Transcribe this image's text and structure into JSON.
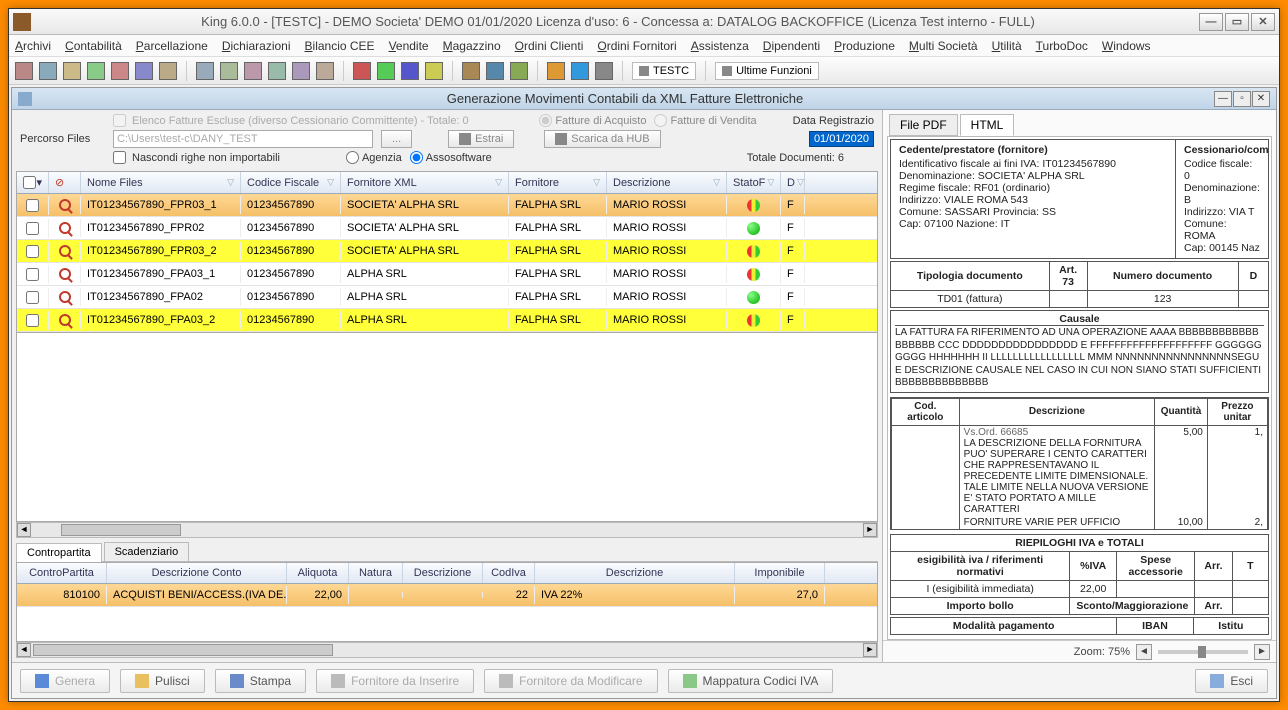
{
  "title": "King 6.0.0 - [TESTC] -    DEMO  Societa' DEMO    01/01/2020     Licenza d'uso: 6 - Concessa a:  DATALOG BACKOFFICE (Licenza Test interno - FULL)",
  "menu": [
    "Archivi",
    "Contabilità",
    "Parcellazione",
    "Dichiarazioni",
    "Bilancio CEE",
    "Vendite",
    "Magazzino",
    "Ordini Clienti",
    "Ordini Fornitori",
    "Assistenza",
    "Dipendenti",
    "Produzione",
    "Multi Società",
    "Utilità",
    "TurboDoc",
    "Windows"
  ],
  "toolbar_txt1": "TESTC",
  "toolbar_txt2": "Ultime Funzioni",
  "subwin_title": "Generazione Movimenti Contabili da XML Fatture Elettroniche",
  "filters": {
    "elenco_escluse": "Elenco Fatture Escluse (diverso Cessionario Committente) - Totale: 0",
    "fatture_acquisto": "Fatture di Acquisto",
    "fatture_vendita": "Fatture di Vendita",
    "data_reg": "Data Registrazio",
    "percorso_label": "Percorso Files",
    "percorso": "C:\\Users\\test-c\\DANY_TEST",
    "browse": "...",
    "nascondi": "Nascondi righe non importabili",
    "agenzia": "Agenzia",
    "assosoftware": "Assosoftware",
    "estrai": "Estrai",
    "scarica": "Scarica da HUB",
    "totale_doc": "Totale Documenti: 6",
    "date": "01/01/2020"
  },
  "grid": {
    "cols": [
      "",
      "",
      "Nome Files",
      "Codice Fiscale",
      "Fornitore XML",
      "Fornitore",
      "Descrizione",
      "StatoF",
      "D"
    ],
    "rows": [
      {
        "cls": "row-orange",
        "file": "IT01234567890_FPR03_1",
        "cf": "01234567890",
        "fxml": "SOCIETA' ALPHA SRL",
        "forn": "FALPHA SRL",
        "descr": "MARIO ROSSI",
        "stato": "ryg",
        "d": "F"
      },
      {
        "cls": "row-white",
        "file": "IT01234567890_FPR02",
        "cf": "01234567890",
        "fxml": "SOCIETA' ALPHA SRL",
        "forn": "FALPHA SRL",
        "descr": "MARIO ROSSI",
        "stato": "green",
        "d": "F"
      },
      {
        "cls": "row-yellow",
        "file": "IT01234567890_FPR03_2",
        "cf": "01234567890",
        "fxml": "SOCIETA' ALPHA SRL",
        "forn": "FALPHA SRL",
        "descr": "MARIO ROSSI",
        "stato": "ryg",
        "d": "F"
      },
      {
        "cls": "row-white",
        "file": "IT01234567890_FPA03_1",
        "cf": "01234567890",
        "fxml": "ALPHA SRL",
        "forn": "FALPHA SRL",
        "descr": "MARIO ROSSI",
        "stato": "ryg",
        "d": "F"
      },
      {
        "cls": "row-white",
        "file": "IT01234567890_FPA02",
        "cf": "01234567890",
        "fxml": "ALPHA SRL",
        "forn": "FALPHA SRL",
        "descr": "MARIO ROSSI",
        "stato": "green",
        "d": "F"
      },
      {
        "cls": "row-yellow",
        "file": "IT01234567890_FPA03_2",
        "cf": "01234567890",
        "fxml": "ALPHA SRL",
        "forn": "FALPHA SRL",
        "descr": "MARIO ROSSI",
        "stato": "ryg",
        "d": "F"
      }
    ]
  },
  "detail_tabs": [
    "Contropartita",
    "Scadenziario"
  ],
  "detail": {
    "cols": [
      "ControPartita",
      "Descrizione Conto",
      "Aliquota",
      "Natura",
      "Descrizione",
      "CodIva",
      "Descrizione",
      "Imponibile"
    ],
    "row": {
      "cp": "810100",
      "dc": "ACQUISTI BENI/ACCESS.(IVA DE...",
      "aliq": "22,00",
      "nat": "",
      "descr1": "",
      "codiva": "22",
      "descr2": "IVA 22%",
      "imp": "27,0"
    }
  },
  "right": {
    "tabs": [
      "File PDF",
      "HTML"
    ],
    "cedente_hdr": "Cedente/prestatore (fornitore)",
    "cedente": {
      "id": "Identificativo fiscale ai fini IVA: IT01234567890",
      "den": "Denominazione: SOCIETA' ALPHA SRL",
      "reg": "Regime fiscale: RF01 (ordinario)",
      "ind": "Indirizzo: VIALE ROMA 543",
      "com": "Comune: SASSARI Provincia: SS",
      "cap": "Cap: 07100 Nazione: IT"
    },
    "cessionario_hdr": "Cessionario/com",
    "cessionario": {
      "cf": "Codice fiscale: 0",
      "den": "Denominazione: B",
      "ind": "Indirizzo: VIA T",
      "com": "Comune: ROMA",
      "cap": "Cap: 00145 Naz"
    },
    "tipo_doc_cols": [
      "Tipologia documento",
      "Art. 73",
      "Numero documento",
      "D"
    ],
    "tipo_doc_row": [
      "TD01 (fattura)",
      "",
      "123",
      ""
    ],
    "causale_label": "Causale",
    "causale": "LA FATTURA FA RIFERIMENTO AD UNA OPERAZIONE AAAA BBBBBBBBBBBBBBBBBB CCC DDDDDDDDDDDDDDDD E FFFFFFFFFFFFFFFFFFFF GGGGGGGGGG HHHHHHH II LLLLLLLLLLLLLLLLL MMM NNNNNNNNNNNNNNNNSEGUE DESCRIZIONE CAUSALE NEL CASO IN CUI NON SIANO STATI SUFFICIENTI BBBBBBBBBBBBBB",
    "lines_cols": [
      "Cod. articolo",
      "Descrizione",
      "Quantità",
      "Prezzo unitar"
    ],
    "lines": [
      {
        "art": "",
        "d1": "Vs.Ord. 66685",
        "d2": "LA DESCRIZIONE DELLA FORNITURA PUO' SUPERARE I CENTO CARATTERI CHE RAPPRESENTAVANO IL PRECEDENTE LIMITE DIMENSIONALE. TALE LIMITE NELLA NUOVA VERSIONE E' STATO PORTATO A MILLE CARATTERI",
        "q": "5,00",
        "p": "1,"
      },
      {
        "art": "",
        "d1": "",
        "d2": "FORNITURE VARIE PER UFFICIO",
        "q": "10,00",
        "p": "2,"
      }
    ],
    "riepiloghi_hdr": "RIEPILOGHI IVA e TOTALI",
    "riep_cols": [
      "esigibilità iva / riferimenti normativi",
      "%IVA",
      "Spese accessorie",
      "Arr.",
      "T"
    ],
    "riep_row": [
      "I (esigibilità immediata)",
      "22,00",
      "",
      "",
      ""
    ],
    "bollo": "Importo bollo",
    "sconto": "Sconto/Maggiorazione",
    "arr": "Arr.",
    "pag_cols": [
      "Modalità pagamento",
      "IBAN",
      "Istitu"
    ]
  },
  "zoom": "Zoom: 75%",
  "footer": [
    "Genera",
    "Pulisci",
    "Stampa",
    "Fornitore da Inserire",
    "Fornitore da Modificare",
    "Mappatura Codici IVA",
    "Esci"
  ]
}
